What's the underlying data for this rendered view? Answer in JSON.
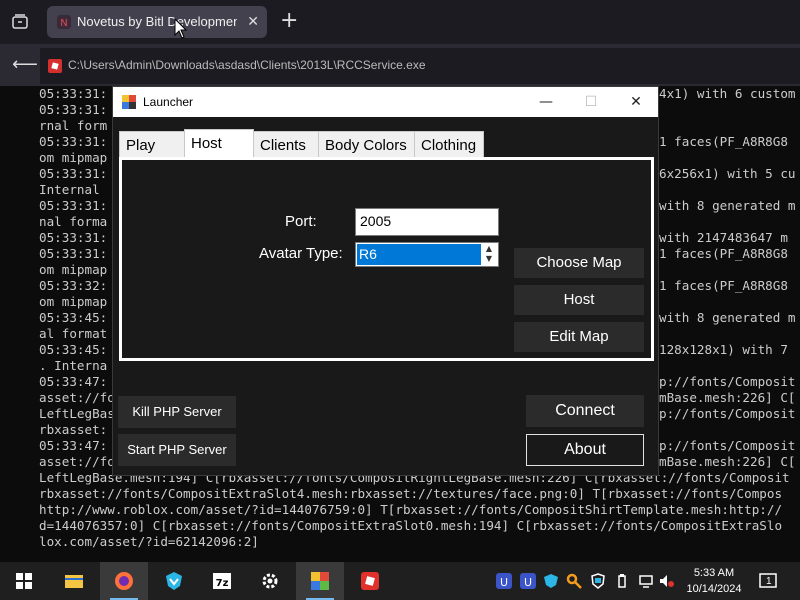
{
  "browser": {
    "tab_title": "Novetus by Bitl Development",
    "url": "C:\\Users\\Admin\\Downloads\\asdasd\\Clients\\2013L\\RCCService.exe"
  },
  "console": {
    "lines": [
      "05:33:31:",
      "05:33:31:",
      "rnal form",
      "05:33:31:",
      "om mipmap",
      "05:33:31:",
      "Internal",
      "05:33:31:",
      "nal forma",
      "05:33:31:",
      "05:33:31:",
      "om mipmap",
      "05:33:32:",
      "om mipmap",
      "05:33:45:",
      "al format",
      "05:33:45:",
      ". Interna",
      "05:33:47:",
      "asset://fo",
      "LeftLegBas",
      "rbxasset:",
      "05:33:47:",
      "asset://fo",
      "LeftLegBase.mesh:194] C[rbxasset://fonts/CompositRightLegBase.mesh:226] C[rbxasset://fonts/Composit",
      "rbxasset://fonts/CompositExtraSlot4.mesh:rbxasset://textures/face.png:0] T[rbxasset://fonts/Compos",
      "http://www.roblox.com/asset/?id=144076759:0] T[rbxasset://fonts/CompositShirtTemplate.mesh:http://",
      "d=144076357:0] C[rbxasset://fonts/CompositExtraSlot0.mesh:194] C[rbxasset://fonts/CompositExtraSlo",
      "lox.com/asset/?id=62142096:2]"
    ],
    "right_lines": [
      {
        "row": 0,
        "text": "4x1) with 6 custom"
      },
      {
        "row": 3,
        "text": "1 faces(PF_A8R8G8"
      },
      {
        "row": 5,
        "text": "6x256x1) with 5 cu"
      },
      {
        "row": 7,
        "text": "with 8 generated m"
      },
      {
        "row": 9,
        "text": "with 2147483647 m"
      },
      {
        "row": 10,
        "text": "1 faces(PF_A8R8G8"
      },
      {
        "row": 12,
        "text": "1 faces(PF_A8R8G8"
      },
      {
        "row": 14,
        "text": "with 8 generated m"
      },
      {
        "row": 16,
        "text": "128x128x1) with 7"
      },
      {
        "row": 18,
        "text": "p://fonts/Composit"
      },
      {
        "row": 19,
        "text": "mBase.mesh:226] C["
      },
      {
        "row": 20,
        "text": "p://fonts/Composit"
      },
      {
        "row": 22,
        "text": "p://fonts/Composit"
      },
      {
        "row": 23,
        "text": "mBase.mesh:226] C["
      }
    ]
  },
  "launcher": {
    "title": "Launcher",
    "tabs": [
      "Play",
      "Host",
      "Clients",
      "Body Colors",
      "Clothing"
    ],
    "active_tab": "Host",
    "port_label": "Port:",
    "port_value": "2005",
    "avatar_label": "Avatar Type:",
    "avatar_value": "R6",
    "choose_map": "Choose Map",
    "host": "Host",
    "edit_map": "Edit Map",
    "kill_php": "Kill PHP Server",
    "start_php": "Start PHP Server",
    "connect": "Connect",
    "about": "About"
  },
  "taskbar": {
    "time": "5:33 AM",
    "date": "10/14/2024",
    "notification_count": "1",
    "app_icons": [
      "start-icon",
      "file-explorer-icon",
      "firefox-icon",
      "shield-app-icon",
      "7zip-icon",
      "settings-gear-icon",
      "novetus-launcher-icon",
      "roblox-icon"
    ]
  }
}
